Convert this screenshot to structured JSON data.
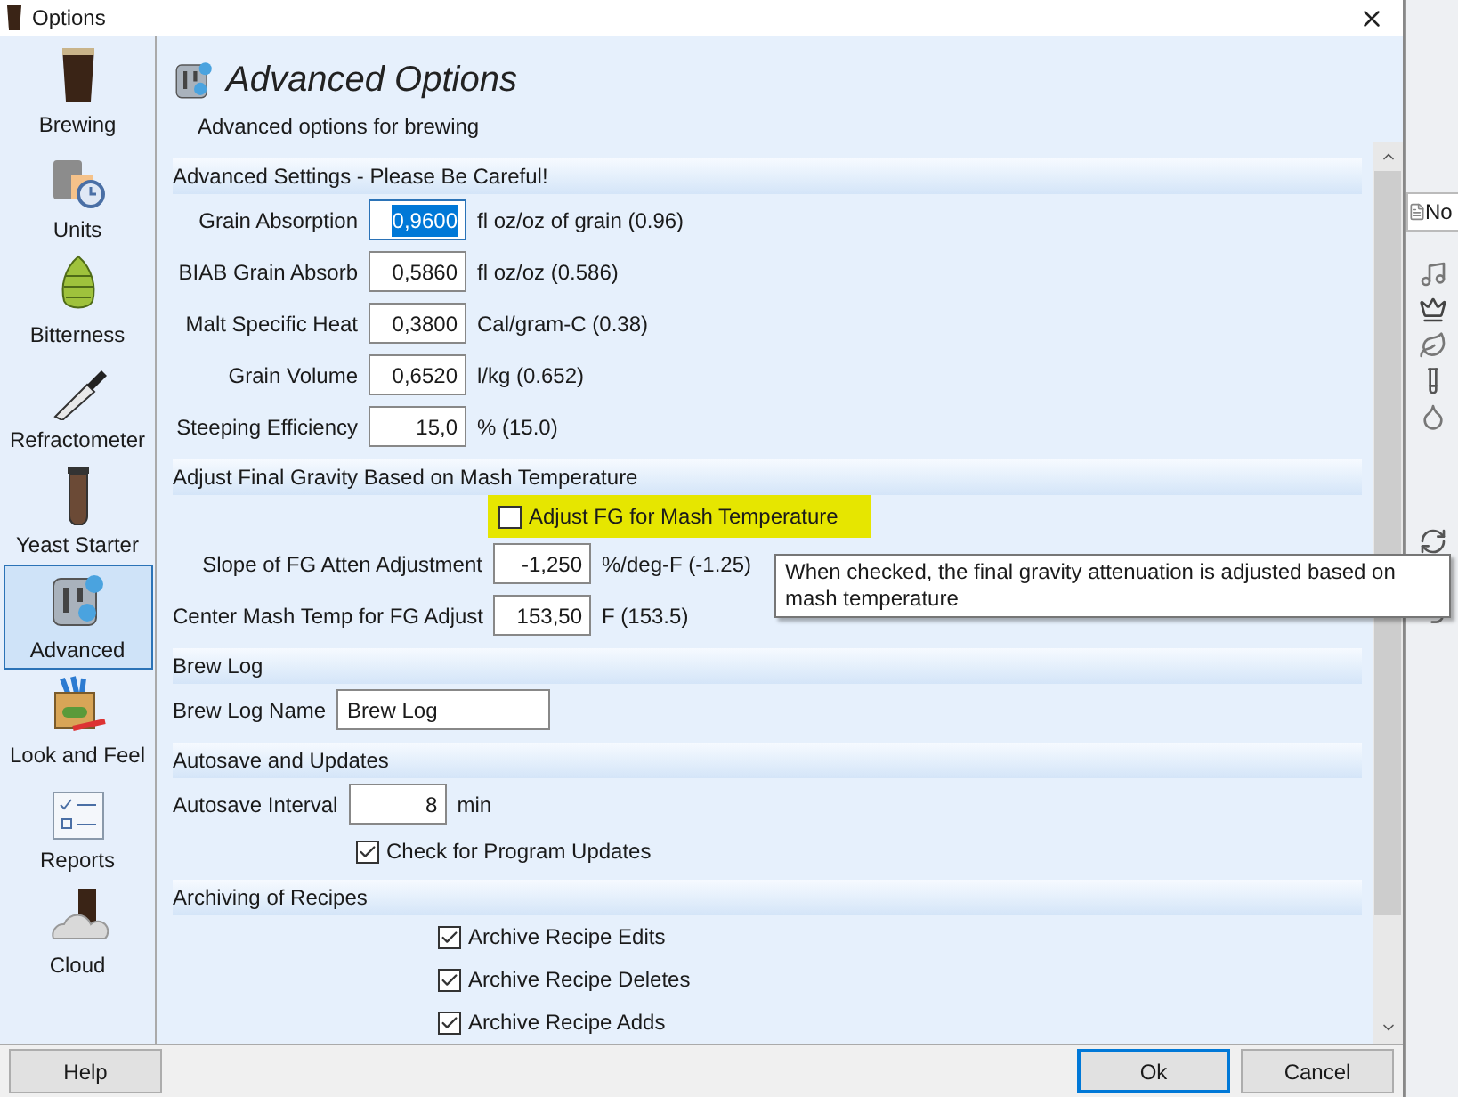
{
  "window": {
    "title": "Options"
  },
  "sidebar": {
    "items": [
      {
        "label": "Brewing",
        "selected": false
      },
      {
        "label": "Units",
        "selected": false
      },
      {
        "label": "Bitterness",
        "selected": false
      },
      {
        "label": "Refractometer",
        "selected": false
      },
      {
        "label": "Yeast Starter",
        "selected": false
      },
      {
        "label": "Advanced",
        "selected": true
      },
      {
        "label": "Look and Feel",
        "selected": false
      },
      {
        "label": "Reports",
        "selected": false
      },
      {
        "label": "Cloud",
        "selected": false
      }
    ]
  },
  "page": {
    "title": "Advanced Options",
    "subtitle": "Advanced options for brewing"
  },
  "sections": [
    {
      "title": "Advanced Settings - Please Be Careful!",
      "rows": [
        {
          "kind": "number",
          "label": "Grain Absorption",
          "value": "0,9600",
          "unit": "fl oz/oz of grain (0.96)",
          "focused": true
        },
        {
          "kind": "number",
          "label": "BIAB Grain Absorb",
          "value": "0,5860",
          "unit": "fl oz/oz (0.586)",
          "focused": false
        },
        {
          "kind": "number",
          "label": "Malt Specific Heat",
          "value": "0,3800",
          "unit": "Cal/gram-C (0.38)",
          "focused": false
        },
        {
          "kind": "number",
          "label": "Grain Volume",
          "value": "0,6520",
          "unit": "l/kg (0.652)",
          "focused": false
        },
        {
          "kind": "number",
          "label": "Steeping Efficiency",
          "value": "15,0",
          "unit": "% (15.0)",
          "focused": false
        }
      ]
    },
    {
      "title": "Adjust Final Gravity Based on Mash Temperature",
      "rows": [
        {
          "kind": "checkbox",
          "label": "Adjust FG for Mash Temperature",
          "checked": false,
          "highlighted": true
        },
        {
          "kind": "number",
          "label": "Slope of FG Atten Adjustment",
          "value": "-1,250",
          "unit": "%/deg-F (-1.25)",
          "focused": false
        },
        {
          "kind": "number",
          "label": "Center Mash Temp for FG Adjust",
          "value": "153,50",
          "unit": "F (153.5)",
          "focused": false
        }
      ]
    },
    {
      "title": "Brew Log",
      "rows": [
        {
          "kind": "text",
          "label": "Brew Log Name",
          "value": "Brew Log"
        }
      ]
    },
    {
      "title": "Autosave and Updates",
      "rows": [
        {
          "kind": "number",
          "label": "Autosave Interval",
          "value": "8",
          "unit": "min",
          "focused": false
        },
        {
          "kind": "checkbox",
          "label": "Check for Program Updates",
          "checked": true,
          "highlighted": false
        }
      ]
    },
    {
      "title": "Archiving of Recipes",
      "rows": [
        {
          "kind": "checkbox",
          "label": "Archive Recipe Edits",
          "checked": true,
          "highlighted": false
        },
        {
          "kind": "checkbox",
          "label": "Archive Recipe Deletes",
          "checked": true,
          "highlighted": false
        },
        {
          "kind": "checkbox",
          "label": "Archive Recipe Adds",
          "checked": true,
          "highlighted": false
        }
      ]
    }
  ],
  "tooltip": "When checked, the final gravity attenuation is adjusted based on mash temperature",
  "buttons": {
    "help": "Help",
    "ok": "Ok",
    "cancel": "Cancel"
  },
  "background_window": {
    "tab": "No"
  }
}
